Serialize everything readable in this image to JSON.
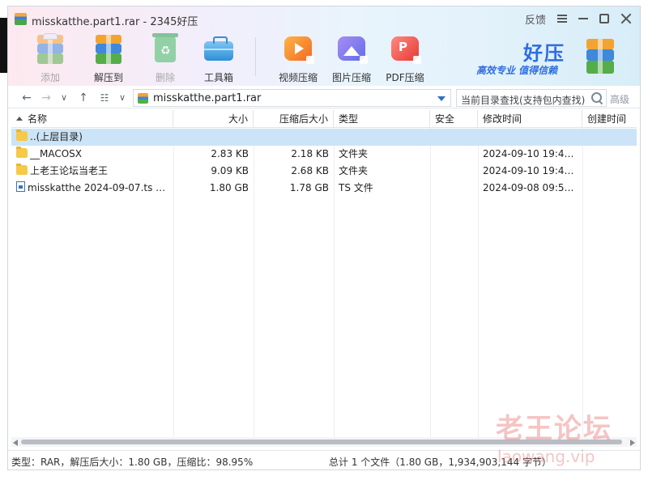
{
  "window": {
    "title": "misskatthe.part1.rar - 2345好压",
    "feedback": "反馈"
  },
  "toolbar": {
    "items": [
      {
        "label": "添加",
        "icon": "archive-add-icon",
        "disabled": true
      },
      {
        "label": "解压到",
        "icon": "archive-extract-icon",
        "disabled": false
      },
      {
        "label": "删除",
        "icon": "recycle-bin-icon",
        "disabled": true
      },
      {
        "label": "工具箱",
        "icon": "toolbox-icon",
        "disabled": false
      },
      {
        "label": "视频压缩",
        "icon": "video-compress-icon",
        "disabled": false
      },
      {
        "label": "图片压缩",
        "icon": "image-compress-icon",
        "disabled": false
      },
      {
        "label": "PDF压缩",
        "icon": "pdf-compress-icon",
        "disabled": false
      }
    ]
  },
  "brand": {
    "name": "好压",
    "slogan": "高效专业  值得信赖"
  },
  "address": {
    "path": "misskatthe.part1.rar",
    "search_placeholder": "当前目录查找(支持包内查找)",
    "advanced": "高级"
  },
  "table": {
    "columns": [
      "名称",
      "大小",
      "压缩后大小",
      "类型",
      "安全",
      "修改时间",
      "创建时间"
    ],
    "rows": [
      {
        "name": "..(上层目录)",
        "icon": "folder-icon",
        "size": "",
        "packed": "",
        "type": "",
        "security": "",
        "modified": "",
        "created": "",
        "selected": true
      },
      {
        "name": "__MACOSX",
        "icon": "folder-icon",
        "size": "2.83 KB",
        "packed": "2.18 KB",
        "type": "文件夹",
        "security": "",
        "modified": "2024-09-10 19:41:...",
        "created": "",
        "selected": false
      },
      {
        "name": "上老王论坛当老王",
        "icon": "folder-icon",
        "size": "9.09 KB",
        "packed": "2.68 KB",
        "type": "文件夹",
        "security": "",
        "modified": "2024-09-10 19:41:...",
        "created": "",
        "selected": false
      },
      {
        "name": "misskatthe 2024-09-07.ts --...",
        "icon": "file-icon",
        "size": "1.80 GB",
        "packed": "1.78 GB",
        "type": "TS 文件",
        "security": "",
        "modified": "2024-09-08 09:58:...",
        "created": "",
        "selected": false
      }
    ]
  },
  "status": {
    "left": "类型：RAR，解压后大小：1.80 GB，压缩比：98.95%",
    "right": "总计 1 个文件（1.80 GB，1,934,903,144 字节）"
  },
  "watermark": {
    "line1": "老王论坛",
    "line2": "laowang.vip"
  }
}
